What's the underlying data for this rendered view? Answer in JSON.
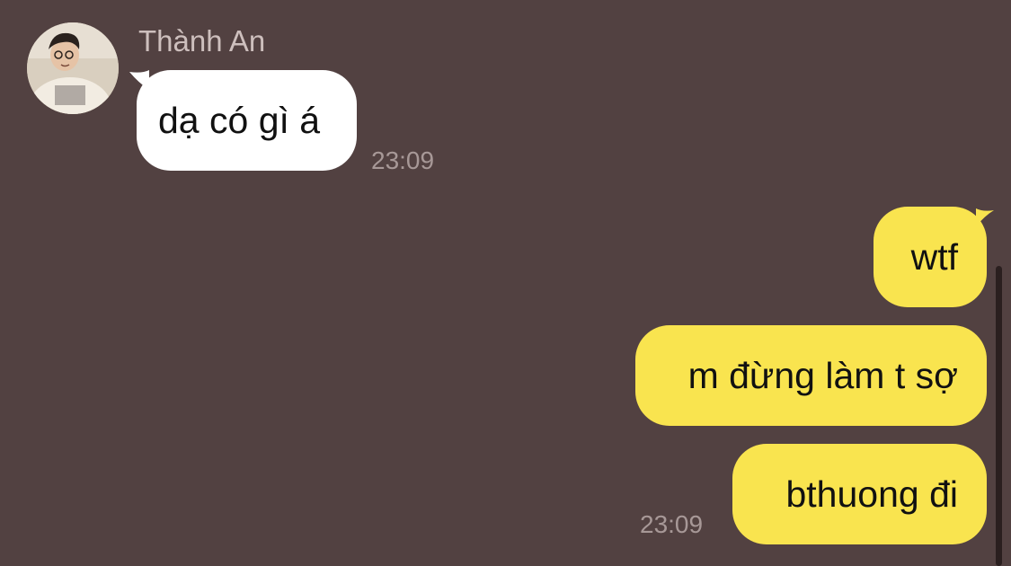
{
  "incoming": {
    "sender_name": "Thành An",
    "message": "dạ có gì á",
    "time": "23:09"
  },
  "outgoing": {
    "messages": [
      "wtf",
      "m đừng làm t sợ",
      "bthuong đi"
    ],
    "time": "23:09"
  },
  "colors": {
    "background": "#524141",
    "incoming_bubble": "#ffffff",
    "outgoing_bubble": "#f9e44f",
    "timestamp": "#a79897",
    "sender_name": "#cdbfbd"
  }
}
